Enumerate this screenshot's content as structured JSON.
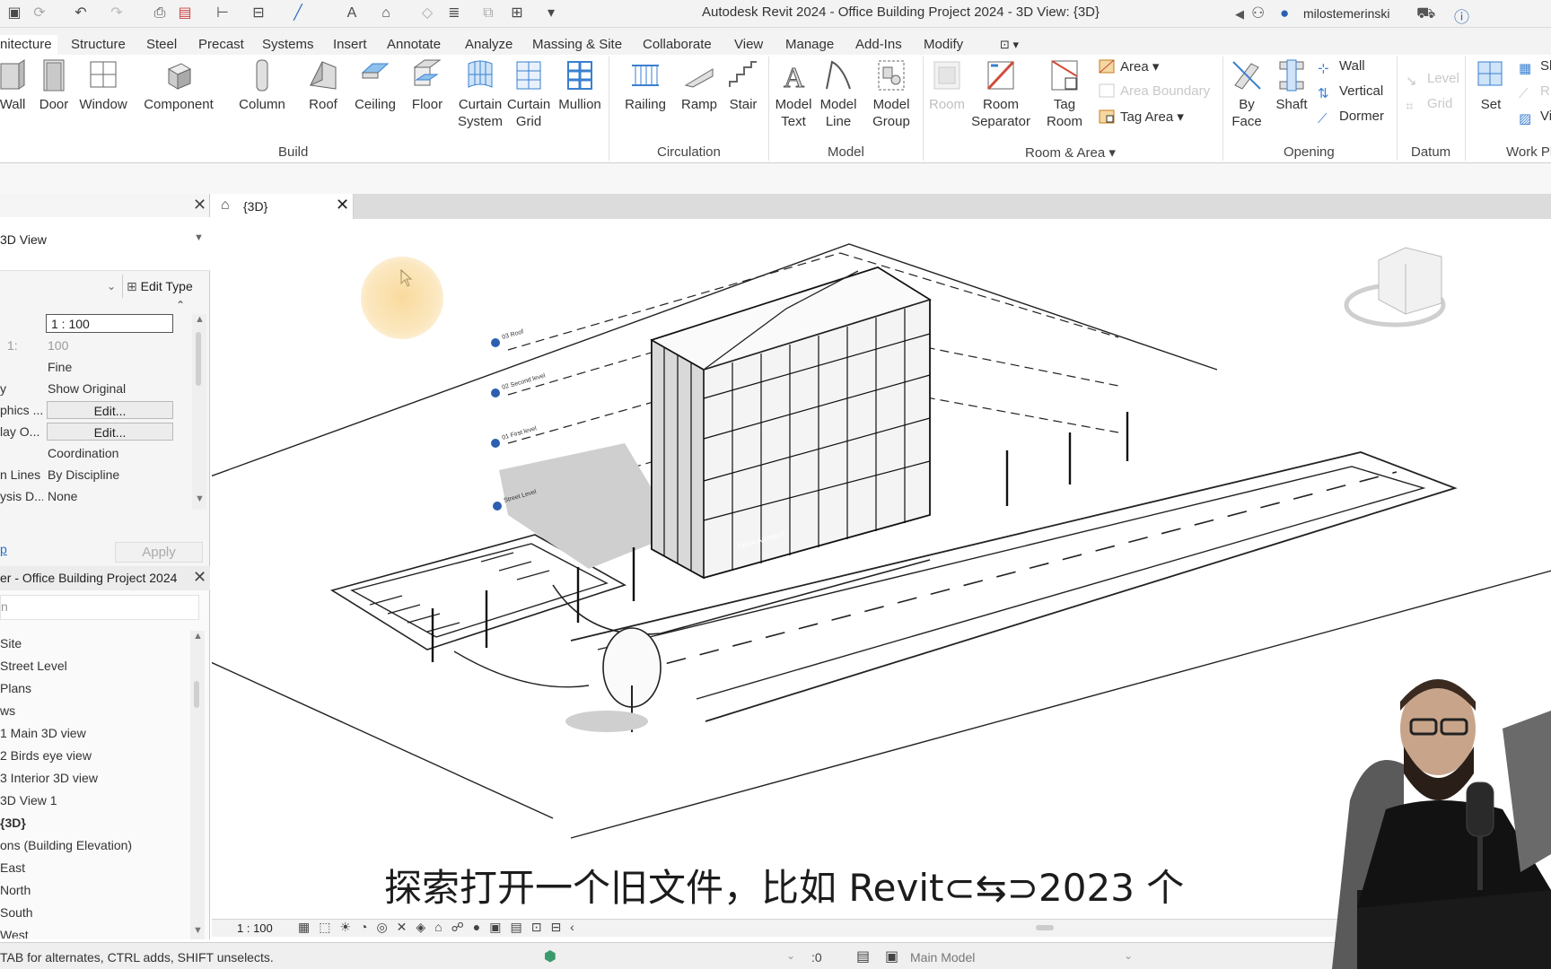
{
  "window": {
    "title": "Autodesk Revit 2024 - Office Building Project 2024 - 3D View: {3D}",
    "user": "milostemerinski"
  },
  "ribbon_tabs": [
    "nitecture",
    "Structure",
    "Steel",
    "Precast",
    "Systems",
    "Insert",
    "Annotate",
    "Analyze",
    "Massing & Site",
    "Collaborate",
    "View",
    "Manage",
    "Add-Ins",
    "Modify"
  ],
  "ribbon": {
    "build": {
      "label": "Build",
      "buttons": [
        "Wall",
        "Door",
        "Window",
        "Component",
        "Column",
        "Roof",
        "Ceiling",
        "Floor",
        "Curtain\nSystem",
        "Curtain\nGrid",
        "Mullion"
      ]
    },
    "circulation": {
      "label": "Circulation",
      "buttons": [
        "Railing",
        "Ramp",
        "Stair"
      ]
    },
    "model": {
      "label": "Model",
      "buttons": [
        "Model\nText",
        "Model\nLine",
        "Model\nGroup"
      ]
    },
    "room_area": {
      "label": "Room & Area",
      "buttons": [
        "Room",
        "Room\nSeparator",
        "Tag\nRoom"
      ],
      "small": [
        "Area",
        "Area  Boundary",
        "Tag  Area"
      ]
    },
    "opening": {
      "label": "Opening",
      "buttons": [
        "By\nFace",
        "Shaft"
      ],
      "small": [
        "Wall",
        "Vertical",
        "Dormer"
      ]
    },
    "datum": {
      "label": "Datum",
      "small": [
        "Level",
        "Grid"
      ]
    },
    "work_plane": {
      "label": "Work Pl",
      "buttons": [
        "Set"
      ]
    }
  },
  "properties": {
    "type_name": "3D View",
    "edit_type": "Edit Type",
    "rows": [
      {
        "key": "",
        "value": "1 : 100",
        "kind": "input"
      },
      {
        "key": "1:",
        "value": "100",
        "kind": "grey"
      },
      {
        "key": "",
        "value": "Fine",
        "kind": "text"
      },
      {
        "key": "y",
        "value": "Show Original",
        "kind": "text"
      },
      {
        "key": "phics ...",
        "value": "Edit...",
        "kind": "button"
      },
      {
        "key": "lay O...",
        "value": "Edit...",
        "kind": "button"
      },
      {
        "key": "",
        "value": "Coordination",
        "kind": "text"
      },
      {
        "key": "n Lines",
        "value": "By Discipline",
        "kind": "text"
      },
      {
        "key": "ysis D...",
        "value": "None",
        "kind": "text"
      }
    ],
    "help": "p",
    "apply": "Apply"
  },
  "browser": {
    "title": "er - Office Building Project 2024",
    "items": [
      {
        "text": "Site",
        "bold": false
      },
      {
        "text": "Street Level",
        "bold": false
      },
      {
        "text": "Plans",
        "bold": false
      },
      {
        "text": "ws",
        "bold": false
      },
      {
        "text": "1 Main 3D view",
        "bold": false
      },
      {
        "text": "2 Birds eye view",
        "bold": false
      },
      {
        "text": "3 Interior 3D view",
        "bold": false
      },
      {
        "text": "3D View 1",
        "bold": false
      },
      {
        "text": "{3D}",
        "bold": true
      },
      {
        "text": "ons (Building Elevation)",
        "bold": false
      },
      {
        "text": "East",
        "bold": false
      },
      {
        "text": "North",
        "bold": false
      },
      {
        "text": "South",
        "bold": false
      },
      {
        "text": "West",
        "bold": false
      }
    ]
  },
  "view_tab": {
    "label": "{3D}"
  },
  "view_control": {
    "scale": "1 : 100"
  },
  "level_tags": [
    "03 Roof",
    "02 Second level",
    "01 First level",
    "Street Level"
  ],
  "building_sign": "Talton Architect",
  "subtitle": "探索打开一个旧文件，比如 Revit⊂⇆⊃2023 个",
  "status": {
    "message": "TAB for alternates, CTRL adds, SHIFT unselects.",
    "select_count": ":0",
    "workset": "Main Model"
  },
  "colors": {
    "accent": "#1e6fcf",
    "ribbon_icon_blue": "#3a7fd0",
    "cursor_glow": "#f8d48c"
  }
}
